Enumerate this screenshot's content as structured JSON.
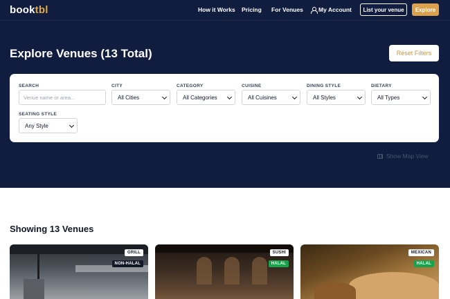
{
  "nav": {
    "logo_main": "book",
    "logo_accent": "tbl",
    "links": [
      "How it Works",
      "Pricing",
      "For Venues"
    ],
    "account_label": "My Account",
    "account_icon": "user-icon",
    "list_venue_label": "List your venue",
    "explore_label": "Explore"
  },
  "header": {
    "title": "Explore Venues (13 Total)",
    "reset_label": "Reset Filters"
  },
  "filters": {
    "search": {
      "label": "SEARCH",
      "placeholder": "Venue name or area..."
    },
    "city": {
      "label": "CITY",
      "value": "All Cities"
    },
    "category": {
      "label": "CATEGORY",
      "value": "All Categories"
    },
    "cuisine": {
      "label": "CUISINE",
      "value": "All Cuisines"
    },
    "dining_style": {
      "label": "DINING STYLE",
      "value": "All Styles"
    },
    "dietary": {
      "label": "DIETARY",
      "value": "All Types"
    },
    "seating_style": {
      "label": "SEATING STYLE",
      "value": "Any Style"
    }
  },
  "map_view": {
    "label": "Show Map View",
    "icon": "map-icon"
  },
  "results": {
    "title": "Showing 13 Venues",
    "cards": [
      {
        "category": "GRILL",
        "dietary": "NON-HALAL"
      },
      {
        "category": "SUSHI",
        "dietary": "HALAL"
      },
      {
        "category": "MEXICAN",
        "dietary": "HALAL"
      }
    ]
  },
  "colors": {
    "hero_bg": "#101d3f",
    "accent": "#dca24b",
    "halal_green": "#16a34a"
  }
}
